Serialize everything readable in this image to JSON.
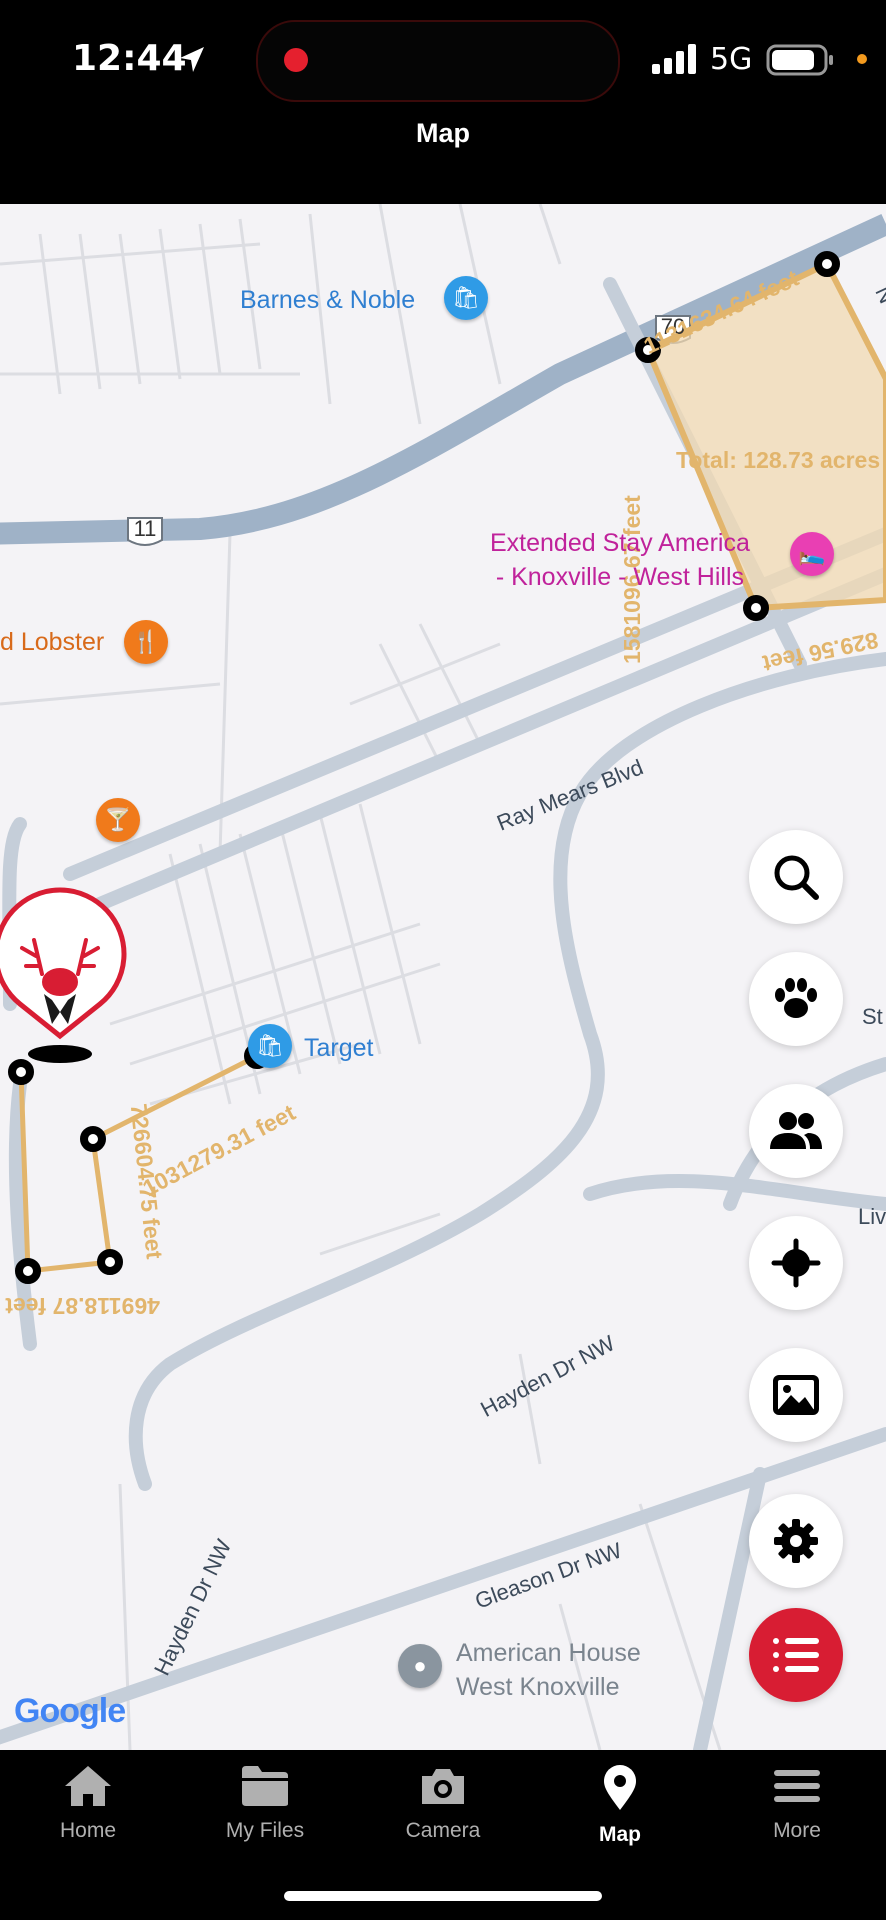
{
  "status_bar": {
    "time": "12:44",
    "network": "5G"
  },
  "header": {
    "title": "Map"
  },
  "map": {
    "pois": {
      "barnes": "Barnes & Noble",
      "extended_stay": "Extended Stay America\n- Knoxville - West Hills",
      "lobster": "d Lobster",
      "target": "Target",
      "american_house": "American House\nWest Knoxville"
    },
    "roads": {
      "ray_mears": "Ray Mears Blvd",
      "hayden_1": "Hayden Dr NW",
      "hayden_2": "Hayden Dr NW",
      "gleason": "Gleason Dr NW",
      "route_11": "11",
      "route_70": "70",
      "n_wi": "N Wi",
      "st": "St",
      "liv": "Liv"
    },
    "measurements": {
      "top_edge": "1131634.64 feet",
      "left_edge": "1581096.67 feet",
      "bottom_edge": "829.56 feet",
      "total": "Total: 128.73 acres",
      "small_top": "1031279.31 feet",
      "small_right": "726604.75 feet",
      "small_bottom": "469118.87 feet"
    },
    "attribution": "Google"
  },
  "fabs": [
    "search-icon",
    "paw-icon",
    "group-icon",
    "crosshair-icon",
    "image-icon",
    "gear-icon",
    "list-icon"
  ],
  "tabs": [
    {
      "label": "Home",
      "icon": "home-icon"
    },
    {
      "label": "My Files",
      "icon": "folder-icon"
    },
    {
      "label": "Camera",
      "icon": "camera-icon"
    },
    {
      "label": "Map",
      "icon": "map-pin-icon",
      "active": true
    },
    {
      "label": "More",
      "icon": "menu-icon"
    }
  ],
  "colors": {
    "accent": "#d81d33",
    "boundary": "#e2b56c",
    "poi_blue": "#2f7fd1",
    "poi_purple": "#c0229b"
  }
}
